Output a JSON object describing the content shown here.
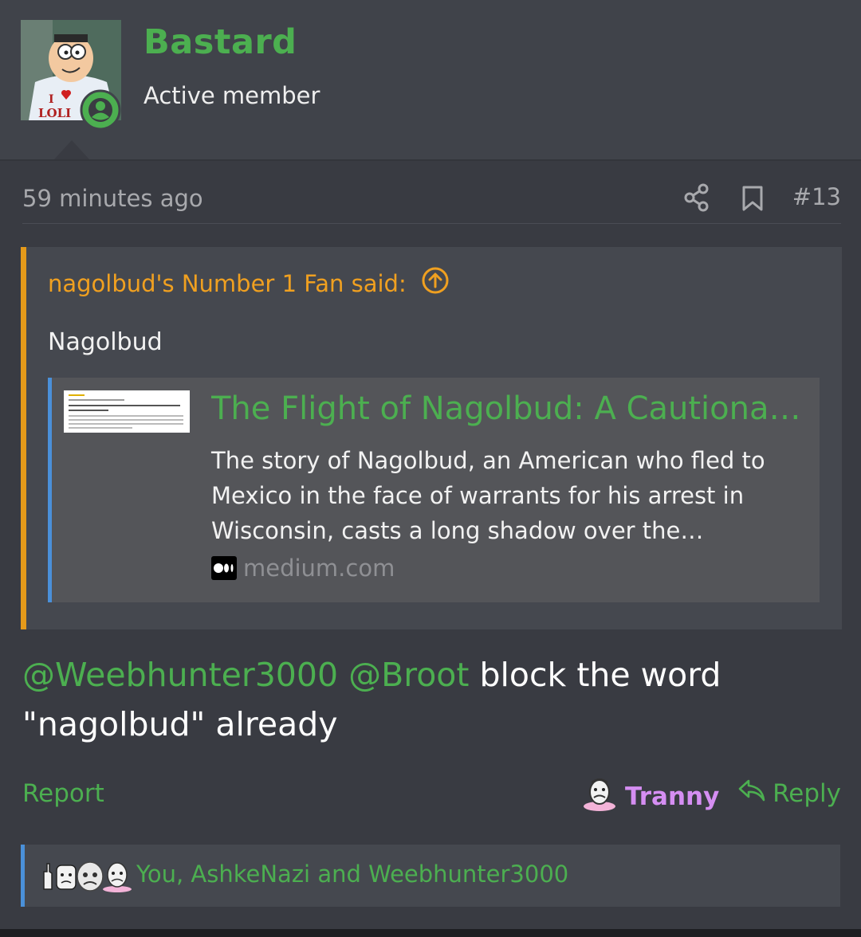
{
  "author": {
    "name": "Bastard",
    "title": "Active member"
  },
  "post": {
    "timestamp": "59 minutes ago",
    "number": "#13",
    "body_mention_1": "@Weebhunter3000",
    "body_mention_2": "@Broot",
    "body_text": "block the word \"nagolbud\" already"
  },
  "quote": {
    "author_line": "nagolbud's Number 1 Fan said:",
    "text": "Nagolbud",
    "embed": {
      "title": "The Flight of Nagolbud: A Cautionary Tale",
      "description": "The story of Nagolbud, an American who fled to Mexico in the face of warrants for his arrest in Wisconsin, casts a long shadow over the…",
      "source": "medium.com"
    }
  },
  "actions": {
    "report_label": "Report",
    "reaction_label": "Tranny",
    "reply_label": "Reply"
  },
  "likes": {
    "text": "You, AshkeNazi and Weebhunter3000"
  },
  "colors": {
    "accent_green": "#4caf50",
    "quote_orange": "#e59a1a",
    "reaction_purple": "#d58ef2",
    "embed_blue": "#4a90d9"
  }
}
